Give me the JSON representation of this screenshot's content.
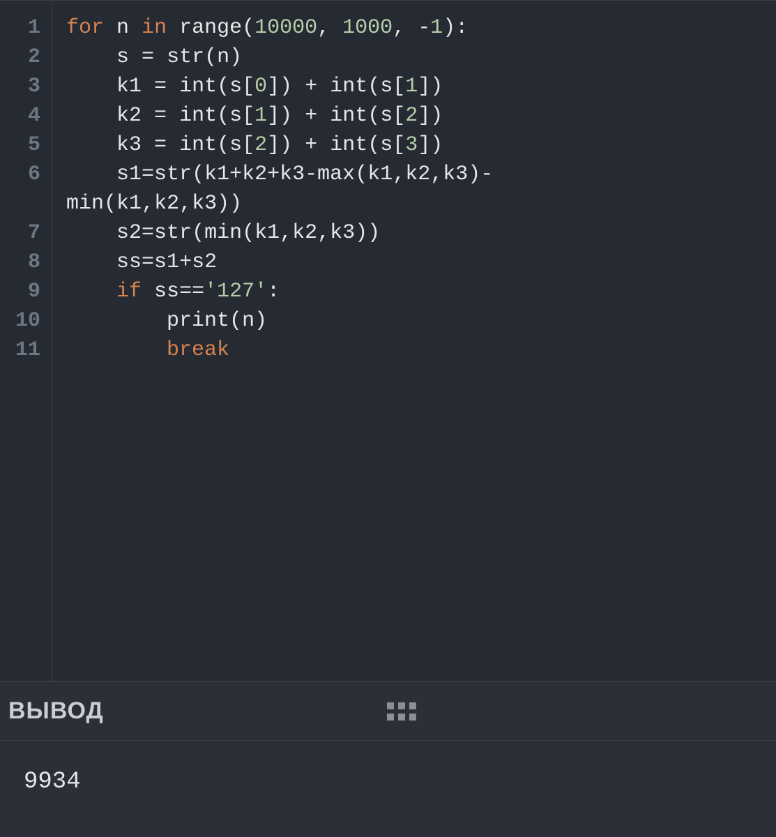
{
  "editor": {
    "line_numbers": [
      "1",
      "2",
      "3",
      "4",
      "5",
      "6",
      "7",
      "8",
      "9",
      "10",
      "11"
    ],
    "lines": [
      {
        "indent": 0,
        "tokens": [
          {
            "t": "kw",
            "v": "for"
          },
          {
            "t": "sp",
            "v": " "
          },
          {
            "t": "id",
            "v": "n"
          },
          {
            "t": "sp",
            "v": " "
          },
          {
            "t": "kw",
            "v": "in"
          },
          {
            "t": "sp",
            "v": " "
          },
          {
            "t": "fn",
            "v": "range"
          },
          {
            "t": "punc",
            "v": "("
          },
          {
            "t": "num",
            "v": "10000"
          },
          {
            "t": "punc",
            "v": ","
          },
          {
            "t": "sp",
            "v": " "
          },
          {
            "t": "num",
            "v": "1000"
          },
          {
            "t": "punc",
            "v": ","
          },
          {
            "t": "sp",
            "v": " "
          },
          {
            "t": "op",
            "v": "-"
          },
          {
            "t": "num",
            "v": "1"
          },
          {
            "t": "punc",
            "v": ")"
          },
          {
            "t": "punc",
            "v": ":"
          }
        ]
      },
      {
        "indent": 1,
        "tokens": [
          {
            "t": "id",
            "v": "s"
          },
          {
            "t": "sp",
            "v": " "
          },
          {
            "t": "op",
            "v": "="
          },
          {
            "t": "sp",
            "v": " "
          },
          {
            "t": "fn",
            "v": "str"
          },
          {
            "t": "punc",
            "v": "("
          },
          {
            "t": "id",
            "v": "n"
          },
          {
            "t": "punc",
            "v": ")"
          }
        ]
      },
      {
        "indent": 1,
        "tokens": [
          {
            "t": "id",
            "v": "k1"
          },
          {
            "t": "sp",
            "v": " "
          },
          {
            "t": "op",
            "v": "="
          },
          {
            "t": "sp",
            "v": " "
          },
          {
            "t": "fn",
            "v": "int"
          },
          {
            "t": "punc",
            "v": "("
          },
          {
            "t": "id",
            "v": "s"
          },
          {
            "t": "punc",
            "v": "["
          },
          {
            "t": "num",
            "v": "0"
          },
          {
            "t": "punc",
            "v": "]"
          },
          {
            "t": "punc",
            "v": ")"
          },
          {
            "t": "sp",
            "v": " "
          },
          {
            "t": "op",
            "v": "+"
          },
          {
            "t": "sp",
            "v": " "
          },
          {
            "t": "fn",
            "v": "int"
          },
          {
            "t": "punc",
            "v": "("
          },
          {
            "t": "id",
            "v": "s"
          },
          {
            "t": "punc",
            "v": "["
          },
          {
            "t": "num",
            "v": "1"
          },
          {
            "t": "punc",
            "v": "]"
          },
          {
            "t": "punc",
            "v": ")"
          }
        ]
      },
      {
        "indent": 1,
        "tokens": [
          {
            "t": "id",
            "v": "k2"
          },
          {
            "t": "sp",
            "v": " "
          },
          {
            "t": "op",
            "v": "="
          },
          {
            "t": "sp",
            "v": " "
          },
          {
            "t": "fn",
            "v": "int"
          },
          {
            "t": "punc",
            "v": "("
          },
          {
            "t": "id",
            "v": "s"
          },
          {
            "t": "punc",
            "v": "["
          },
          {
            "t": "num",
            "v": "1"
          },
          {
            "t": "punc",
            "v": "]"
          },
          {
            "t": "punc",
            "v": ")"
          },
          {
            "t": "sp",
            "v": " "
          },
          {
            "t": "op",
            "v": "+"
          },
          {
            "t": "sp",
            "v": " "
          },
          {
            "t": "fn",
            "v": "int"
          },
          {
            "t": "punc",
            "v": "("
          },
          {
            "t": "id",
            "v": "s"
          },
          {
            "t": "punc",
            "v": "["
          },
          {
            "t": "num",
            "v": "2"
          },
          {
            "t": "punc",
            "v": "]"
          },
          {
            "t": "punc",
            "v": ")"
          }
        ]
      },
      {
        "indent": 1,
        "tokens": [
          {
            "t": "id",
            "v": "k3"
          },
          {
            "t": "sp",
            "v": " "
          },
          {
            "t": "op",
            "v": "="
          },
          {
            "t": "sp",
            "v": " "
          },
          {
            "t": "fn",
            "v": "int"
          },
          {
            "t": "punc",
            "v": "("
          },
          {
            "t": "id",
            "v": "s"
          },
          {
            "t": "punc",
            "v": "["
          },
          {
            "t": "num",
            "v": "2"
          },
          {
            "t": "punc",
            "v": "]"
          },
          {
            "t": "punc",
            "v": ")"
          },
          {
            "t": "sp",
            "v": " "
          },
          {
            "t": "op",
            "v": "+"
          },
          {
            "t": "sp",
            "v": " "
          },
          {
            "t": "fn",
            "v": "int"
          },
          {
            "t": "punc",
            "v": "("
          },
          {
            "t": "id",
            "v": "s"
          },
          {
            "t": "punc",
            "v": "["
          },
          {
            "t": "num",
            "v": "3"
          },
          {
            "t": "punc",
            "v": "]"
          },
          {
            "t": "punc",
            "v": ")"
          }
        ]
      },
      {
        "indent": 1,
        "wrap": true,
        "tokens": [
          {
            "t": "id",
            "v": "s1"
          },
          {
            "t": "op",
            "v": "="
          },
          {
            "t": "fn",
            "v": "str"
          },
          {
            "t": "punc",
            "v": "("
          },
          {
            "t": "id",
            "v": "k1"
          },
          {
            "t": "op",
            "v": "+"
          },
          {
            "t": "id",
            "v": "k2"
          },
          {
            "t": "op",
            "v": "+"
          },
          {
            "t": "id",
            "v": "k3"
          },
          {
            "t": "op",
            "v": "-"
          },
          {
            "t": "fn",
            "v": "max"
          },
          {
            "t": "punc",
            "v": "("
          },
          {
            "t": "id",
            "v": "k1"
          },
          {
            "t": "punc",
            "v": ","
          },
          {
            "t": "id",
            "v": "k2"
          },
          {
            "t": "punc",
            "v": ","
          },
          {
            "t": "id",
            "v": "k3"
          },
          {
            "t": "punc",
            "v": ")"
          },
          {
            "t": "op",
            "v": "-"
          },
          {
            "t": "br",
            "v": ""
          },
          {
            "t": "fn",
            "v": "min"
          },
          {
            "t": "punc",
            "v": "("
          },
          {
            "t": "id",
            "v": "k1"
          },
          {
            "t": "punc",
            "v": ","
          },
          {
            "t": "id",
            "v": "k2"
          },
          {
            "t": "punc",
            "v": ","
          },
          {
            "t": "id",
            "v": "k3"
          },
          {
            "t": "punc",
            "v": ")"
          },
          {
            "t": "punc",
            "v": ")"
          }
        ]
      },
      {
        "indent": 1,
        "tokens": [
          {
            "t": "id",
            "v": "s2"
          },
          {
            "t": "op",
            "v": "="
          },
          {
            "t": "fn",
            "v": "str"
          },
          {
            "t": "punc",
            "v": "("
          },
          {
            "t": "fn",
            "v": "min"
          },
          {
            "t": "punc",
            "v": "("
          },
          {
            "t": "id",
            "v": "k1"
          },
          {
            "t": "punc",
            "v": ","
          },
          {
            "t": "id",
            "v": "k2"
          },
          {
            "t": "punc",
            "v": ","
          },
          {
            "t": "id",
            "v": "k3"
          },
          {
            "t": "punc",
            "v": ")"
          },
          {
            "t": "punc",
            "v": ")"
          }
        ]
      },
      {
        "indent": 1,
        "tokens": [
          {
            "t": "id",
            "v": "ss"
          },
          {
            "t": "op",
            "v": "="
          },
          {
            "t": "id",
            "v": "s1"
          },
          {
            "t": "op",
            "v": "+"
          },
          {
            "t": "id",
            "v": "s2"
          }
        ]
      },
      {
        "indent": 1,
        "tokens": [
          {
            "t": "kw",
            "v": "if"
          },
          {
            "t": "sp",
            "v": " "
          },
          {
            "t": "id",
            "v": "ss"
          },
          {
            "t": "op",
            "v": "=="
          },
          {
            "t": "str",
            "v": "'127'"
          },
          {
            "t": "punc",
            "v": ":"
          }
        ]
      },
      {
        "indent": 2,
        "tokens": [
          {
            "t": "fn",
            "v": "print"
          },
          {
            "t": "punc",
            "v": "("
          },
          {
            "t": "id",
            "v": "n"
          },
          {
            "t": "punc",
            "v": ")"
          }
        ]
      },
      {
        "indent": 2,
        "tokens": [
          {
            "t": "kw",
            "v": "break"
          }
        ]
      }
    ]
  },
  "output": {
    "title": "ВЫВОД",
    "result": "9934"
  }
}
